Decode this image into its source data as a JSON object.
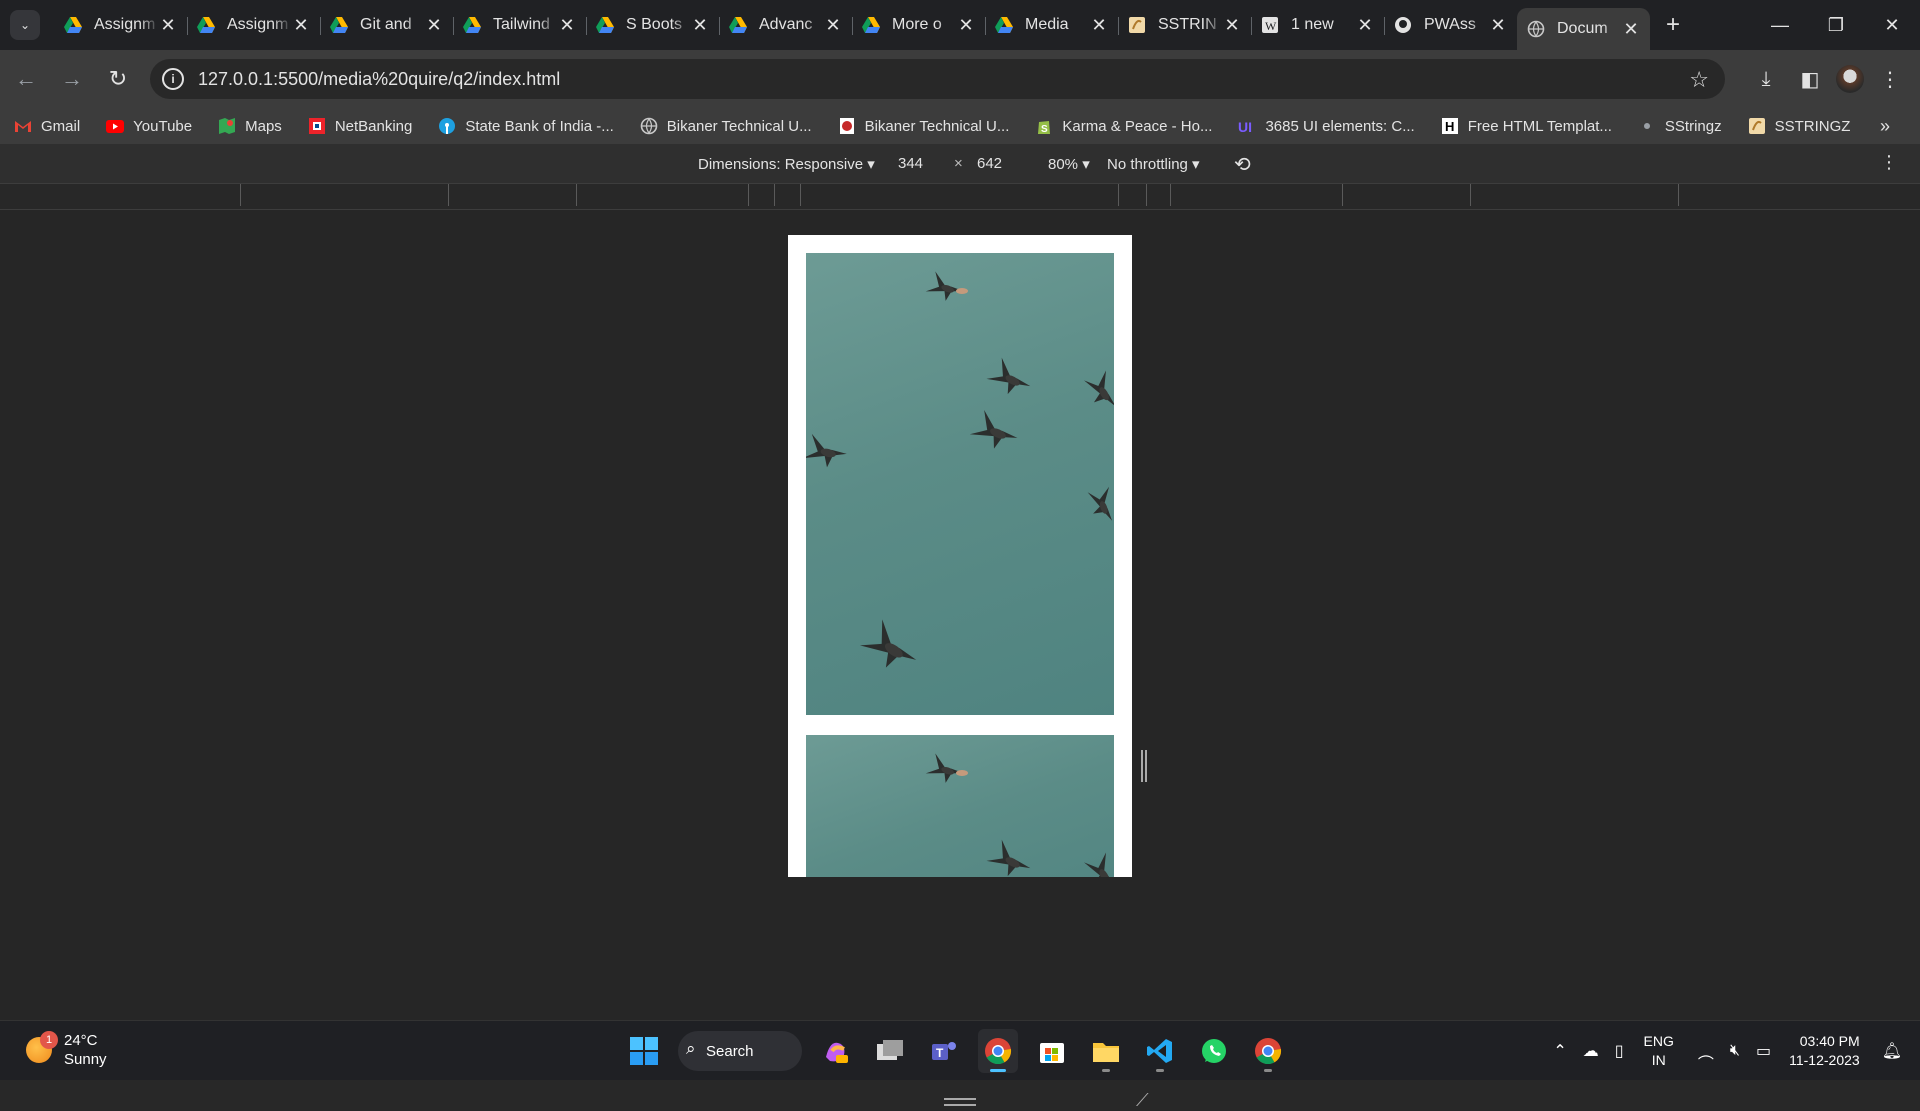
{
  "tabs": [
    {
      "title": "Assignm",
      "icon": "drive-icon"
    },
    {
      "title": "Assignm",
      "icon": "drive-icon"
    },
    {
      "title": "Git and",
      "icon": "drive-icon"
    },
    {
      "title": "Tailwind",
      "icon": "drive-icon"
    },
    {
      "title": "S Boots",
      "icon": "drive-icon"
    },
    {
      "title": "Advanc",
      "icon": "drive-icon"
    },
    {
      "title": "More o",
      "icon": "drive-icon"
    },
    {
      "title": "Media",
      "icon": "drive-icon"
    },
    {
      "title": "SSTRIN",
      "icon": "sstringz-icon"
    },
    {
      "title": "1 new",
      "icon": "wordpress-icon"
    },
    {
      "title": "PWAss",
      "icon": "github-icon"
    },
    {
      "title": "Docum",
      "icon": "globe-icon",
      "active": true
    }
  ],
  "window_controls": {
    "minimize": "—",
    "restore": "❐",
    "close": "✕"
  },
  "address": {
    "url": "127.0.0.1:5500/media%20quire/q2/index.html"
  },
  "bookmarks": [
    {
      "label": "Gmail",
      "icon": "gmail-icon"
    },
    {
      "label": "YouTube",
      "icon": "youtube-icon"
    },
    {
      "label": "Maps",
      "icon": "maps-icon"
    },
    {
      "label": "NetBanking",
      "icon": "hdfc-icon"
    },
    {
      "label": "State Bank of India -...",
      "icon": "sbi-icon"
    },
    {
      "label": "Bikaner Technical U...",
      "icon": "globe-icon"
    },
    {
      "label": "Bikaner Technical U...",
      "icon": "university-icon"
    },
    {
      "label": "Karma & Peace - Ho...",
      "icon": "shopify-icon"
    },
    {
      "label": "3685 UI elements: C...",
      "icon": "uiverse-icon"
    },
    {
      "label": "Free HTML Templat...",
      "icon": "h-icon"
    },
    {
      "label": "SStringz",
      "icon": "sstringz-dot-icon"
    },
    {
      "label": "SSTRINGZ",
      "icon": "sstringz-icon"
    }
  ],
  "devtools": {
    "dimensions_label": "Dimensions: Responsive",
    "width": "344",
    "times": "×",
    "height": "642",
    "zoom": "80%",
    "throttling": "No throttling"
  },
  "taskbar": {
    "weather_temp": "24°C",
    "weather_desc": "Sunny",
    "weather_badge": "1",
    "search_label": "Search",
    "lang_top": "ENG",
    "lang_bottom": "IN",
    "time": "03:40 PM",
    "date": "11-12-2023"
  }
}
